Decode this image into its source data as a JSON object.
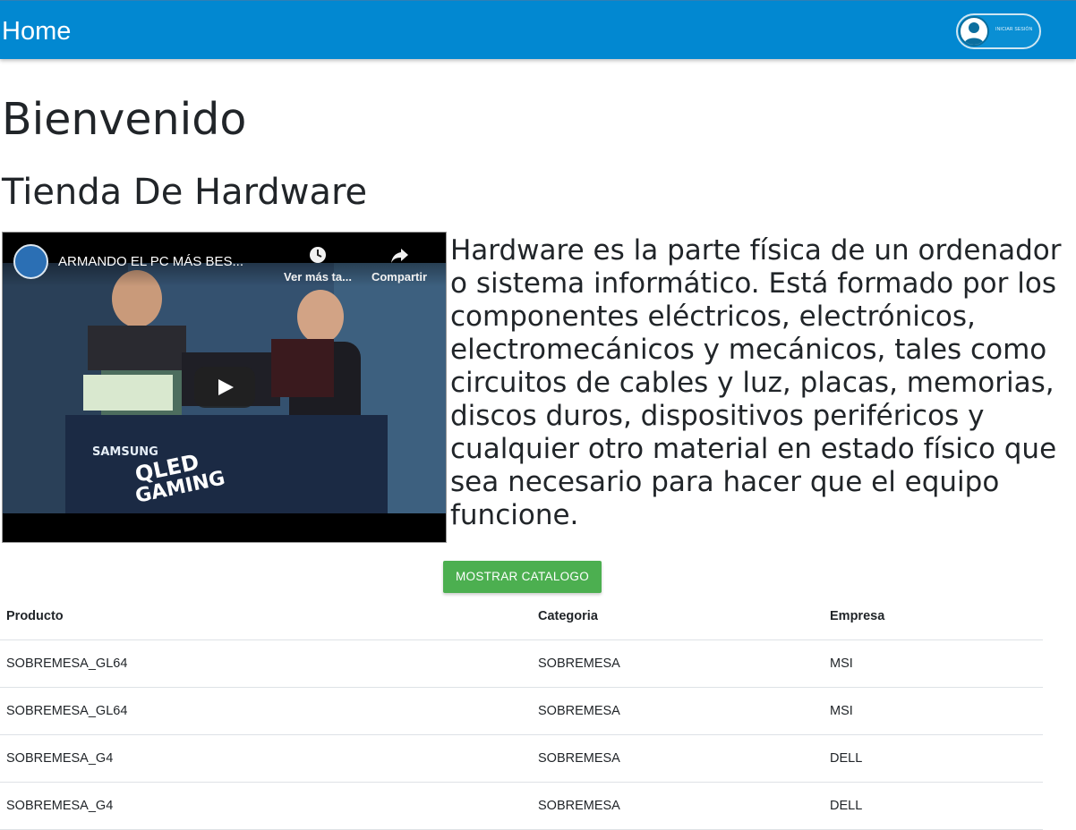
{
  "navbar": {
    "title": "Home",
    "login_label": "INICIAR SESIÓN"
  },
  "main": {
    "heading": "Bienvenido",
    "subheading": "Tienda De Hardware",
    "description": "Hardware es la parte física de un ordenador o sistema informático. Está formado por los componentes eléctricos, electrónicos, electromecánicos y mecánicos, tales como circuitos de cables y luz, placas, memorias, discos duros, dispositivos periféricos y cualquier otro material en estado físico que sea necesario para hacer que el equipo funcione.",
    "catalog_button": "MOSTRAR CATALOGO"
  },
  "video": {
    "title": "ARMANDO EL PC MÁS BES...",
    "watch_later": "Ver más ta...",
    "share": "Compartir",
    "watch_later_icon": "clock-icon",
    "share_icon": "share-arrow-icon"
  },
  "table": {
    "headers": [
      "Producto",
      "Categoria",
      "Empresa"
    ],
    "rows": [
      [
        "SOBREMESA_GL64",
        "SOBREMESA",
        "MSI"
      ],
      [
        "SOBREMESA_GL64",
        "SOBREMESA",
        "MSI"
      ],
      [
        "SOBREMESA_G4",
        "SOBREMESA",
        "DELL"
      ],
      [
        "SOBREMESA_G4",
        "SOBREMESA",
        "DELL"
      ]
    ]
  },
  "colors": {
    "navbar": "#0288d1",
    "button": "#4caf50"
  }
}
